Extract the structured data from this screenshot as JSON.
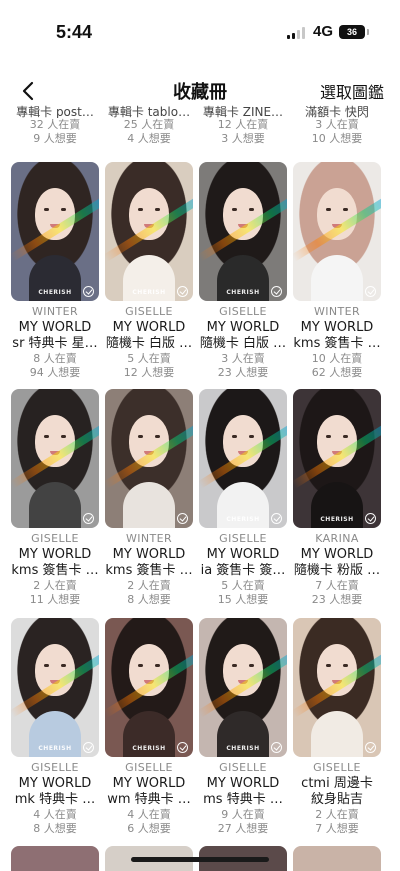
{
  "status": {
    "time": "5:44",
    "network": "4G",
    "battery": "36"
  },
  "header": {
    "title": "收藏冊",
    "select_label": "選取圖鑑",
    "back_icon": "chevron-left-icon"
  },
  "peek_row": [
    {
      "name": "專輯卡 post…",
      "sellers": "32 人在賣",
      "wants": "9 人想要"
    },
    {
      "name": "專輯卡 tablo…",
      "sellers": "25 人在賣",
      "wants": "4 人想要"
    },
    {
      "name": "專輯卡 ZINE…",
      "sellers": "12 人在賣",
      "wants": "3 人想要"
    },
    {
      "name": "滿額卡 快閃",
      "sellers": "3 人在賣",
      "wants": "10 人想要"
    }
  ],
  "cards": [
    {
      "member": "WINTER",
      "album": "MY WORLD",
      "name": "sr 特典卡 星…",
      "sellers": "8 人在賣",
      "wants": "94 人想要",
      "brand": "CHERISH",
      "bg": "#6a6f86",
      "hair": "#2f2522",
      "top": "#2b2b33"
    },
    {
      "member": "GISELLE",
      "album": "MY WORLD",
      "name": "隨機卡 白版 …",
      "sellers": "5 人在賣",
      "wants": "12 人想要",
      "brand": "CHERISH",
      "bg": "#d9cdbf",
      "hair": "#3a2c27",
      "top": "#f4efe9"
    },
    {
      "member": "GISELLE",
      "album": "MY WORLD",
      "name": "隨機卡 白版 …",
      "sellers": "3 人在賣",
      "wants": "23 人想要",
      "brand": "CHERISH",
      "bg": "#7d7b79",
      "hair": "#1f1a19",
      "top": "#2a2a2a"
    },
    {
      "member": "WINTER",
      "album": "MY WORLD",
      "name": "kms 簽售卡 …",
      "sellers": "10 人在賣",
      "wants": "62 人想要",
      "brand": "",
      "bg": "#ece9e6",
      "hair": "#caa294",
      "top": "#f5f5f5"
    },
    {
      "member": "GISELLE",
      "album": "MY WORLD",
      "name": "kms 簽售卡 …",
      "sellers": "2 人在賣",
      "wants": "11 人想要",
      "brand": "",
      "bg": "#9b9b9b",
      "hair": "#272221",
      "top": "#434343"
    },
    {
      "member": "WINTER",
      "album": "MY WORLD",
      "name": "kms 簽售卡 …",
      "sellers": "2 人在賣",
      "wants": "8 人想要",
      "brand": "",
      "bg": "#8d7f77",
      "hair": "#3c2f2a",
      "top": "#e8e3de"
    },
    {
      "member": "GISELLE",
      "album": "MY WORLD",
      "name": "ia 簽售卡 簽…",
      "sellers": "5 人在賣",
      "wants": "15 人想要",
      "brand": "CHERISH",
      "bg": "#c9c9cb",
      "hair": "#1c1818",
      "top": "#f2f2f2"
    },
    {
      "member": "KARINA",
      "album": "MY WORLD",
      "name": "隨機卡 粉版 …",
      "sellers": "7 人在賣",
      "wants": "23 人想要",
      "brand": "CHERISH",
      "bg": "#3d3437",
      "hair": "#1d1717",
      "top": "#171414"
    },
    {
      "member": "GISELLE",
      "album": "MY WORLD",
      "name": "mk 特典卡 …",
      "sellers": "4 人在賣",
      "wants": "8 人想要",
      "brand": "CHERISH",
      "bg": "#dcdcdc",
      "hair": "#2a2322",
      "top": "#b8cbe0"
    },
    {
      "member": "GISELLE",
      "album": "MY WORLD",
      "name": "wm 特典卡 …",
      "sellers": "4 人在賣",
      "wants": "6 人想要",
      "brand": "CHERISH",
      "bg": "#7a5852",
      "hair": "#231a18",
      "top": "#3c2b28"
    },
    {
      "member": "GISELLE",
      "album": "MY WORLD",
      "name": "ms 特典卡 …",
      "sellers": "9 人在賣",
      "wants": "27 人想要",
      "brand": "CHERISH",
      "bg": "#c4b6b0",
      "hair": "#201a18",
      "top": "#2f2a29"
    },
    {
      "member": "GISELLE",
      "album": "ctmi 周邊卡",
      "name": "紋身貼吉",
      "sellers": "2 人在賣",
      "wants": "7 人想要",
      "brand": "",
      "bg": "#d9c6b5",
      "hair": "#3b2b23",
      "top": "#f1ebe4"
    }
  ],
  "bottom_peek": [
    {
      "bg": "#8e6f73"
    },
    {
      "bg": "#d6cfc8"
    },
    {
      "bg": "#5b4a4a"
    },
    {
      "bg": "#c9b3a7"
    }
  ]
}
